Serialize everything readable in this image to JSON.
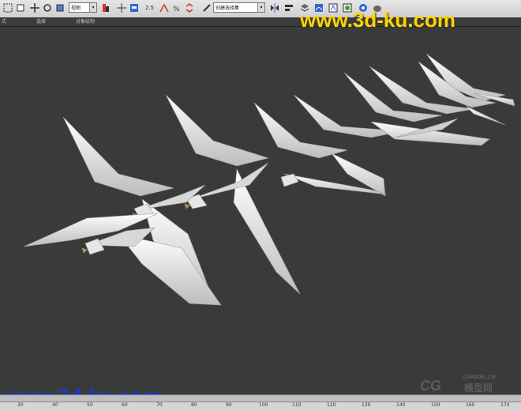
{
  "toolbar": {
    "viewport_select": "视图",
    "selection_set": "创建选择集",
    "snap_num": "2.5",
    "icons": [
      "select-rect-icon",
      "move-icon",
      "rotate-icon",
      "scale-icon",
      "reference-icon",
      "mirror-icon",
      "align-icon",
      "snap-icon",
      "angle-snap-icon",
      "percent-snap-icon",
      "spinner-snap-icon",
      "edit-named-icon",
      "layer-icon",
      "graph-icon",
      "material-icon",
      "render-icon",
      "teapot-icon"
    ]
  },
  "ribbon": {
    "items": [
      "式",
      "选择",
      "对象绘制"
    ]
  },
  "watermarks": {
    "top": "www.3d-ku.com",
    "bottom": "www.3d-ku.com",
    "cg_logo": "CG",
    "cg_url": "CGMODEL.CN",
    "cg_name": "模型网"
  },
  "timeline": {
    "ticks": [
      "30",
      "40",
      "50",
      "60",
      "70",
      "80",
      "90",
      "100",
      "110",
      "120",
      "130",
      "140",
      "150",
      "160",
      "170"
    ]
  },
  "colors": {
    "viewport_bg": "#3a3a3a",
    "accent_yellow": "#ffd400",
    "watermark_blue": "#1a38d8"
  }
}
